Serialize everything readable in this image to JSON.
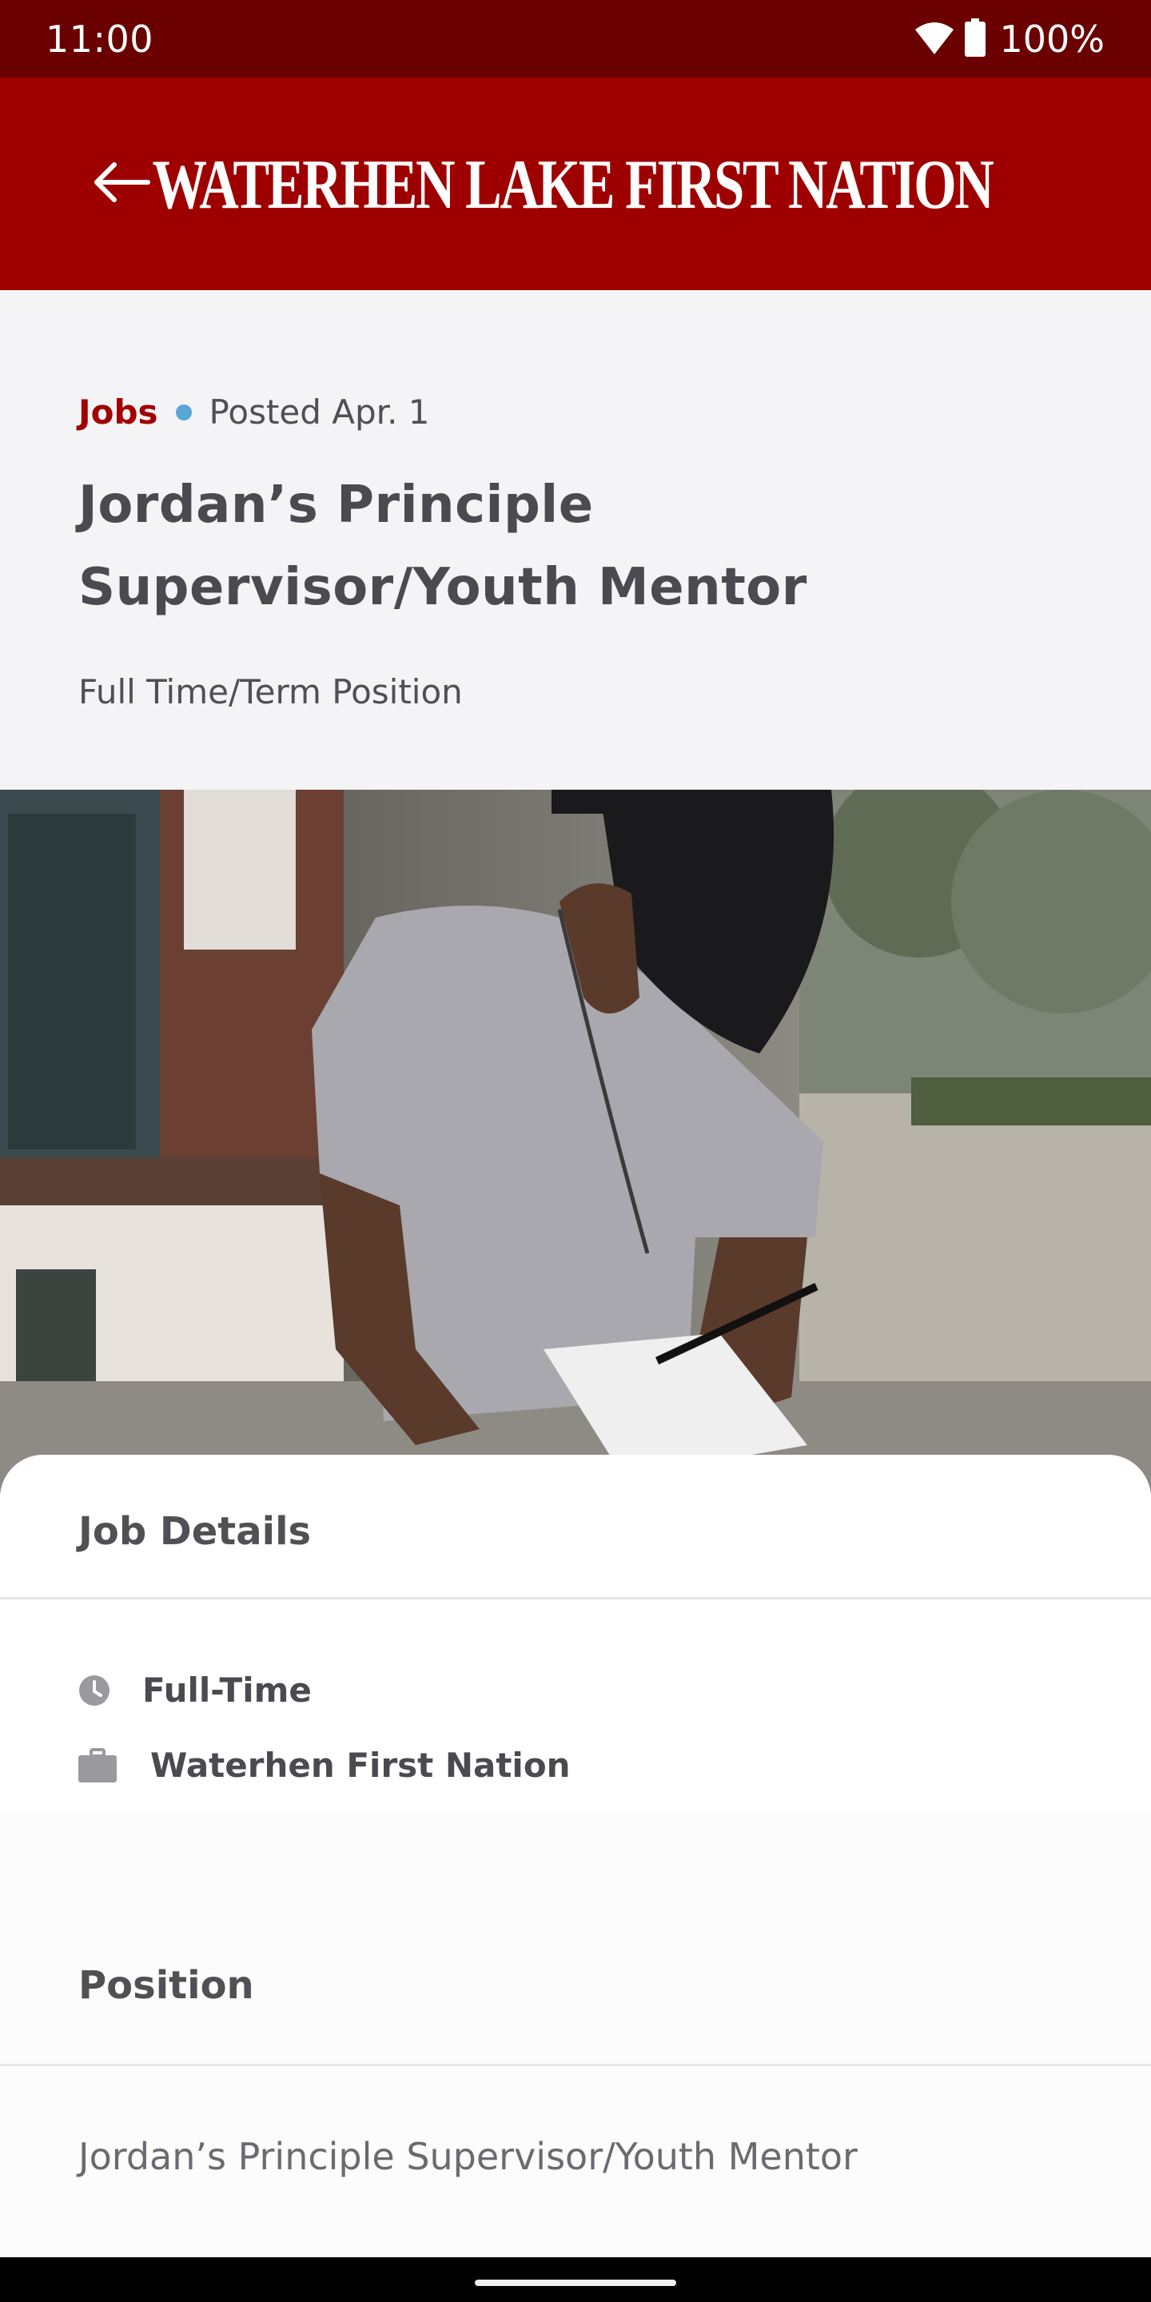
{
  "status_bar": {
    "time": "11:00",
    "battery": "100%"
  },
  "app_bar": {
    "brand": "WATERHEN LAKE FIRST NATION"
  },
  "job": {
    "category": "Jobs",
    "posted": "Posted Apr. 1",
    "title": "Jordan’s Principle Supervisor/Youth Mentor",
    "subtitle": "Full Time/Term Position"
  },
  "details": {
    "heading": "Job Details",
    "employment_type": "Full-Time",
    "employer": "Waterhen First Nation"
  },
  "position": {
    "heading": "Position",
    "text": "Jordan’s Principle Supervisor/Youth Mentor"
  },
  "colors": {
    "status_bar": "#6a0000",
    "app_bar": "#9e0000",
    "accent": "#a00000",
    "dot": "#5aa6d6"
  }
}
